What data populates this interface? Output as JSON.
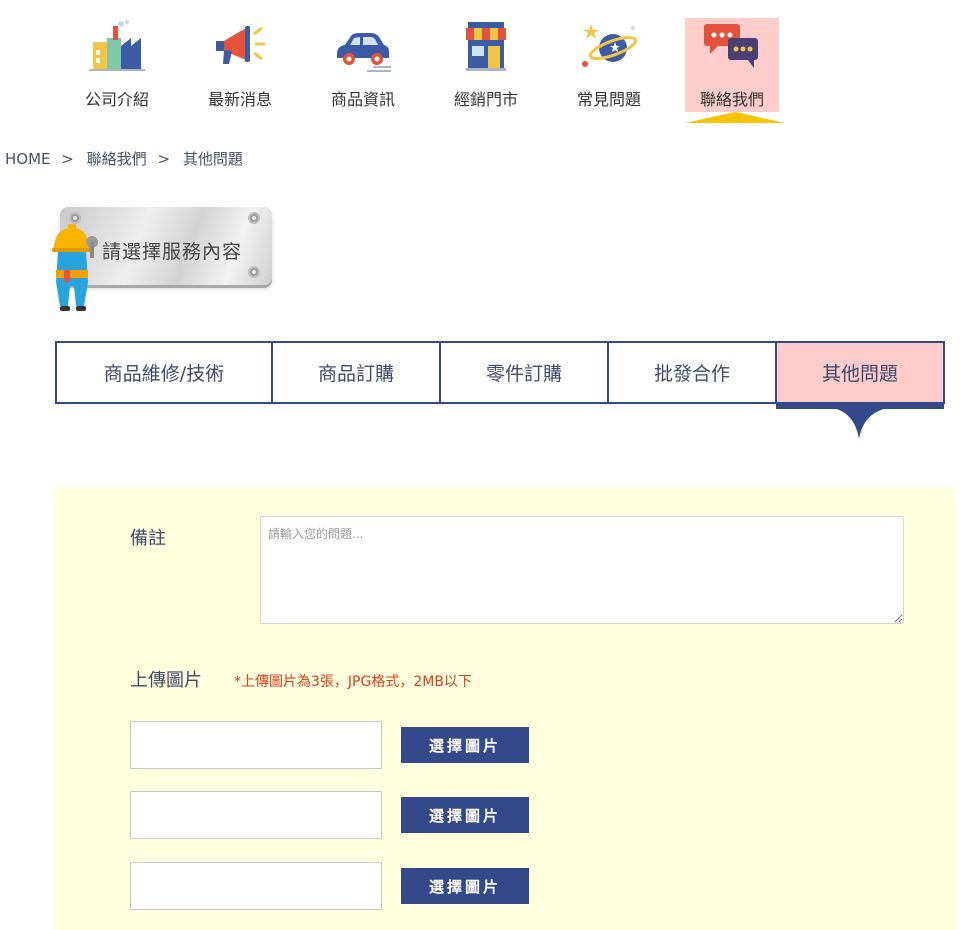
{
  "nav": {
    "items": [
      {
        "label": "公司介紹",
        "icon": "factory-icon"
      },
      {
        "label": "最新消息",
        "icon": "megaphone-icon"
      },
      {
        "label": "商品資訊",
        "icon": "car-icon"
      },
      {
        "label": "經銷門市",
        "icon": "storefront-icon"
      },
      {
        "label": "常見問題",
        "icon": "planet-icon"
      },
      {
        "label": "聯絡我們",
        "icon": "chat-bubbles-icon"
      }
    ],
    "active_index": 5
  },
  "breadcrumb": {
    "items": [
      "HOME",
      "聯絡我們",
      "其他問題"
    ],
    "separator": ">"
  },
  "service_plate": {
    "label": "請選擇服務內容"
  },
  "tabs": {
    "items": [
      "商品維修/技術",
      "商品訂購",
      "零件訂購",
      "批發合作",
      "其他問題"
    ],
    "active_index": 4
  },
  "form": {
    "remark_label": "備註",
    "remark_placeholder": "請輸入您的問題...",
    "remark_value": "",
    "upload_label": "上傳圖片",
    "upload_note": "*上傳圖片為3張，JPG格式，2MB以下",
    "upload_slots": [
      {
        "button_label": "選擇圖片",
        "file_name": ""
      },
      {
        "button_label": "選擇圖片",
        "file_name": ""
      },
      {
        "button_label": "選擇圖片",
        "file_name": ""
      }
    ]
  },
  "colors": {
    "accent_blue": "#34498a",
    "active_pink": "#ffcccc",
    "form_background": "#ffffdd",
    "note_red": "#d9401f",
    "pointer_yellow": "#f6c400"
  }
}
